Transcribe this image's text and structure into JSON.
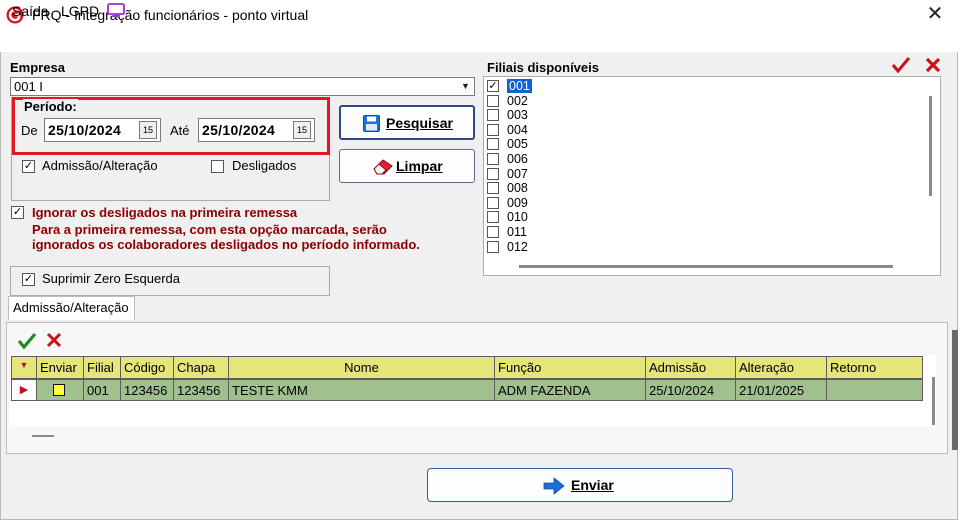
{
  "window": {
    "title": "FRQ - Integração funcionários - ponto virtual",
    "close_symbol": "✕"
  },
  "menu": [
    {
      "label": "Saída"
    },
    {
      "label": "LGPD"
    }
  ],
  "icons": {
    "app": "app-logo-icon",
    "lgpd": "monitor-icon",
    "search": "floppy-disk-icon",
    "clear": "eraser-icon",
    "confirm": "check-icon",
    "cancel": "x-icon"
  },
  "colors": {
    "highlight_box": "#e0191f",
    "grid_header": "#e5e57a",
    "grid_row": "#a0c090",
    "warning_text": "#8b0000",
    "selection": "#0a64d6"
  },
  "empresa": {
    "label": "Empresa",
    "value": "001 I"
  },
  "periodo": {
    "legend": "Período:",
    "from_label": "De",
    "from_value": "25/10/2024",
    "to_label": "Até",
    "to_value": "25/10/2024",
    "calendar_label": "15"
  },
  "options": {
    "admissao": {
      "label": "Admissão/Alteração",
      "checked": true
    },
    "desligados": {
      "label": "Desligados",
      "checked": false
    },
    "ignorar": {
      "label": "Ignorar os desligados na primeira remessa",
      "checked": true,
      "note_line1": "Para a primeira remessa, com esta opção marcada, serão",
      "note_line2": "ignorados os colaboradores desligados no período informado."
    },
    "suprimir": {
      "label": "Suprimir Zero Esquerda",
      "checked": true
    }
  },
  "buttons": {
    "pesquisar": "Pesquisar",
    "limpar": "Limpar",
    "enviar": "Enviar"
  },
  "filiais": {
    "label": "Filiais disponíveis",
    "items": [
      {
        "code": "001",
        "checked": true,
        "selected": true
      },
      {
        "code": "002",
        "checked": false
      },
      {
        "code": "003",
        "checked": false
      },
      {
        "code": "004",
        "checked": false
      },
      {
        "code": "005",
        "checked": false
      },
      {
        "code": "006",
        "checked": false
      },
      {
        "code": "007",
        "checked": false
      },
      {
        "code": "008",
        "checked": false
      },
      {
        "code": "009",
        "checked": false
      },
      {
        "code": "010",
        "checked": false
      },
      {
        "code": "011",
        "checked": false
      },
      {
        "code": "012",
        "checked": false
      }
    ]
  },
  "tab": {
    "label": "Admissão/Alteração"
  },
  "grid": {
    "columns": [
      "Enviar",
      "Filial",
      "Código",
      "Chapa",
      "Nome",
      "Função",
      "Admissão",
      "Alteração",
      "Retorno"
    ],
    "rows": [
      {
        "enviar": "",
        "filial": "001",
        "codigo": "123456",
        "chapa": "123456",
        "nome": "TESTE KMM",
        "funcao": "ADM FAZENDA",
        "admissao": "25/10/2024",
        "alteracao": "21/01/2025",
        "retorno": ""
      }
    ]
  }
}
